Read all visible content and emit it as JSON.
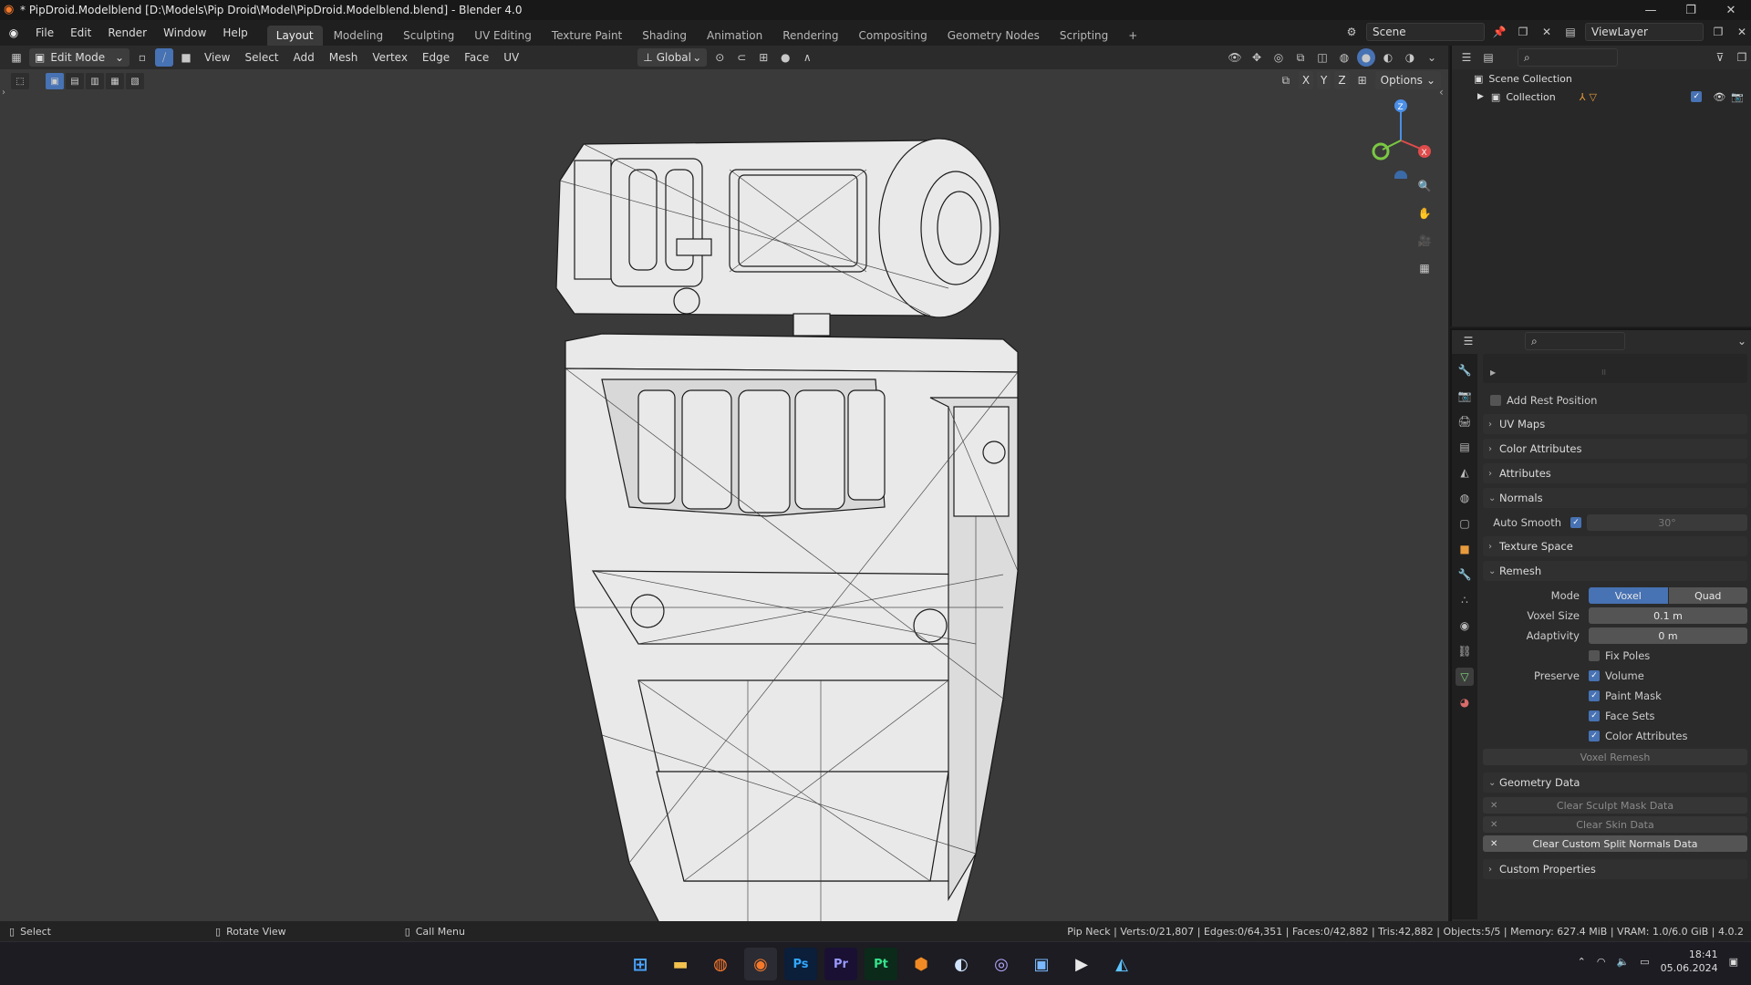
{
  "window": {
    "title": "* PipDroid.Modelblend [D:\\Models\\Pip Droid\\Model\\PipDroid.Modelblend.blend] - Blender 4.0"
  },
  "menus": [
    "File",
    "Edit",
    "Render",
    "Window",
    "Help"
  ],
  "workspaces": [
    "Layout",
    "Modeling",
    "Sculpting",
    "UV Editing",
    "Texture Paint",
    "Shading",
    "Animation",
    "Rendering",
    "Compositing",
    "Geometry Nodes",
    "Scripting"
  ],
  "scene": {
    "name": "Scene",
    "view_layer": "ViewLayer"
  },
  "viewport_header": {
    "mode": "Edit Mode",
    "menus": [
      "View",
      "Select",
      "Add",
      "Mesh",
      "Vertex",
      "Edge",
      "Face",
      "UV"
    ],
    "orientation": "Global",
    "options": "Options",
    "axes": [
      "X",
      "Y",
      "Z"
    ]
  },
  "outliner": {
    "scene_collection": "Scene Collection",
    "collection": "Collection"
  },
  "properties": {
    "add_rest_position": "Add Rest Position",
    "uv_maps": "UV Maps",
    "color_attributes": "Color Attributes",
    "attributes": "Attributes",
    "normals": "Normals",
    "auto_smooth_label": "Auto Smooth",
    "auto_smooth_value": "30°",
    "texture_space": "Texture Space",
    "remesh": "Remesh",
    "mode_label": "Mode",
    "mode_voxel": "Voxel",
    "mode_quad": "Quad",
    "voxel_size_label": "Voxel Size",
    "voxel_size_value": "0.1 m",
    "adaptivity_label": "Adaptivity",
    "adaptivity_value": "0 m",
    "fix_poles": "Fix Poles",
    "preserve_label": "Preserve",
    "preserve_volume": "Volume",
    "preserve_paint_mask": "Paint Mask",
    "preserve_face_sets": "Face Sets",
    "preserve_color_attributes": "Color Attributes",
    "voxel_remesh": "Voxel Remesh",
    "geometry_data": "Geometry Data",
    "clear_sculpt_mask": "Clear Sculpt Mask Data",
    "clear_skin": "Clear Skin Data",
    "clear_custom_split": "Clear Custom Split Normals Data",
    "custom_properties": "Custom Properties"
  },
  "status": {
    "select": "Select",
    "rotate": "Rotate View",
    "call_menu": "Call Menu",
    "stats": "Pip Neck | Verts:0/21,807 | Edges:0/64,351 | Faces:0/42,882 | Tris:42,882 | Objects:5/5 | Memory: 627.4 MiB | VRAM: 1.0/6.0 GiB | 4.0.2"
  },
  "taskbar": {
    "apps": [
      "Ps",
      "Pr",
      "Pt"
    ],
    "time": "18:41",
    "date": "05.06.2024"
  },
  "colors": {
    "accent": "#4772b3",
    "viewport_bg": "#3a3a3a",
    "active_tab": "#7fd67f"
  }
}
